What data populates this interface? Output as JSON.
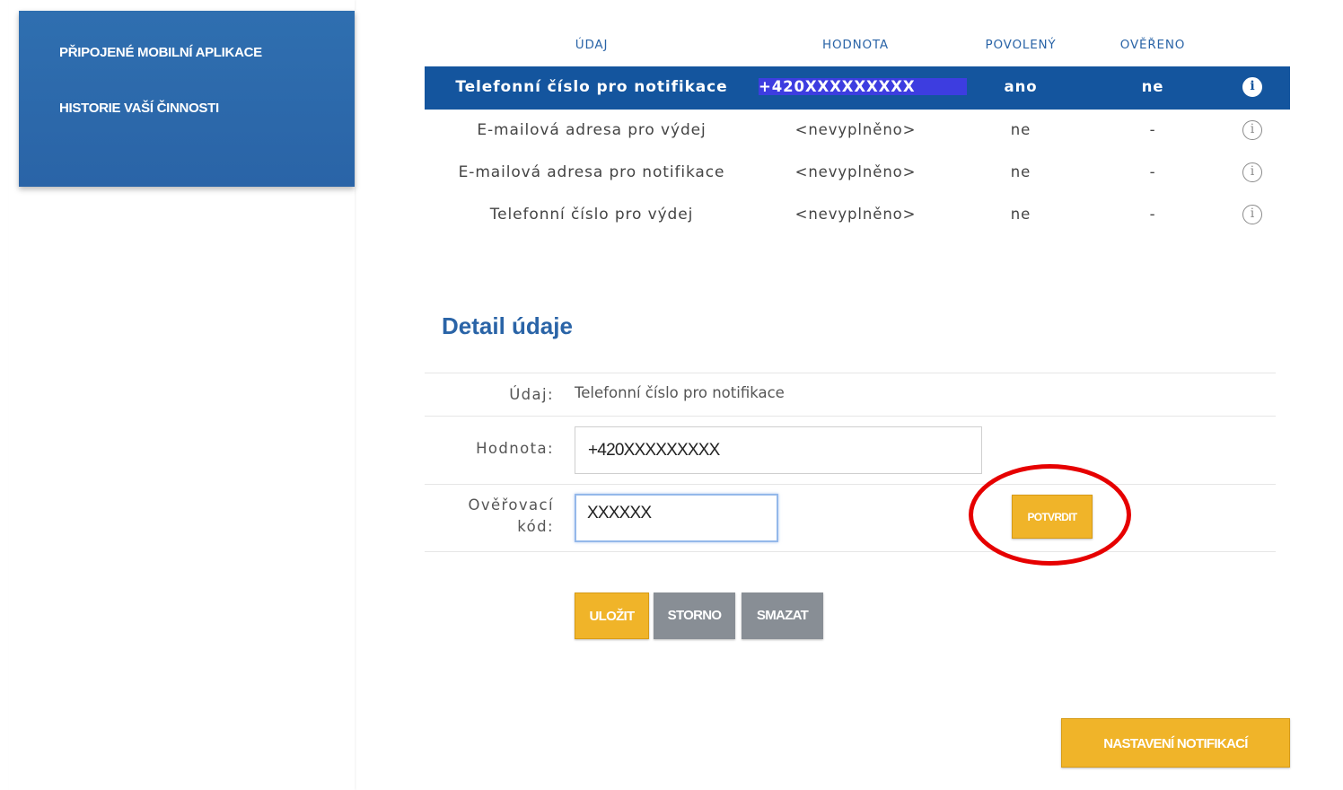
{
  "sidebar": {
    "items": [
      {
        "label": "PŘIPOJENÉ MOBILNÍ APLIKACE"
      },
      {
        "label": "HISTORIE VAŠÍ ČINNOSTI"
      }
    ]
  },
  "table": {
    "headers": {
      "udaj": "ÚDAJ",
      "hodnota": "HODNOTA",
      "povoleny": "POVOLENÝ",
      "overeno": "OVĚŘENO"
    },
    "rows": [
      {
        "udaj": "Telefonní číslo pro notifikace",
        "hodnota": "+420XXXXXXXXX",
        "povoleny": "ano",
        "overeno": "ne",
        "selected": true
      },
      {
        "udaj": "E-mailová adresa pro výdej",
        "hodnota": "<nevyplněno>",
        "povoleny": "ne",
        "overeno": "-"
      },
      {
        "udaj": "E-mailová adresa pro notifikace",
        "hodnota": "<nevyplněno>",
        "povoleny": "ne",
        "overeno": "-"
      },
      {
        "udaj": "Telefonní číslo pro výdej",
        "hodnota": "<nevyplněno>",
        "povoleny": "ne",
        "overeno": "-"
      }
    ],
    "info_icon": "info-circle-icon"
  },
  "detail": {
    "title": "Detail údaje",
    "udaj_label": "Údaj:",
    "udaj_value": "Telefonní číslo pro notifikace",
    "hodnota_label": "Hodnota:",
    "hodnota_value": "+420XXXXXXXXX",
    "kod_label_line1": "Ověřovací",
    "kod_label_line2": "kód:",
    "kod_value": "XXXXXX",
    "confirm_label": "POTVRDIT"
  },
  "actions": {
    "save_label": "ULOŽIT",
    "storno_label": "STORNO",
    "delete_label": "SMAZAT",
    "notifications_label": "NASTAVENÍ NOTIFIKACÍ"
  },
  "colors": {
    "accent_blue": "#2a64a7",
    "selected_row": "#14559e",
    "button_yellow": "#f0b429",
    "button_gray": "#888e95",
    "annotation_red": "#e60000"
  }
}
